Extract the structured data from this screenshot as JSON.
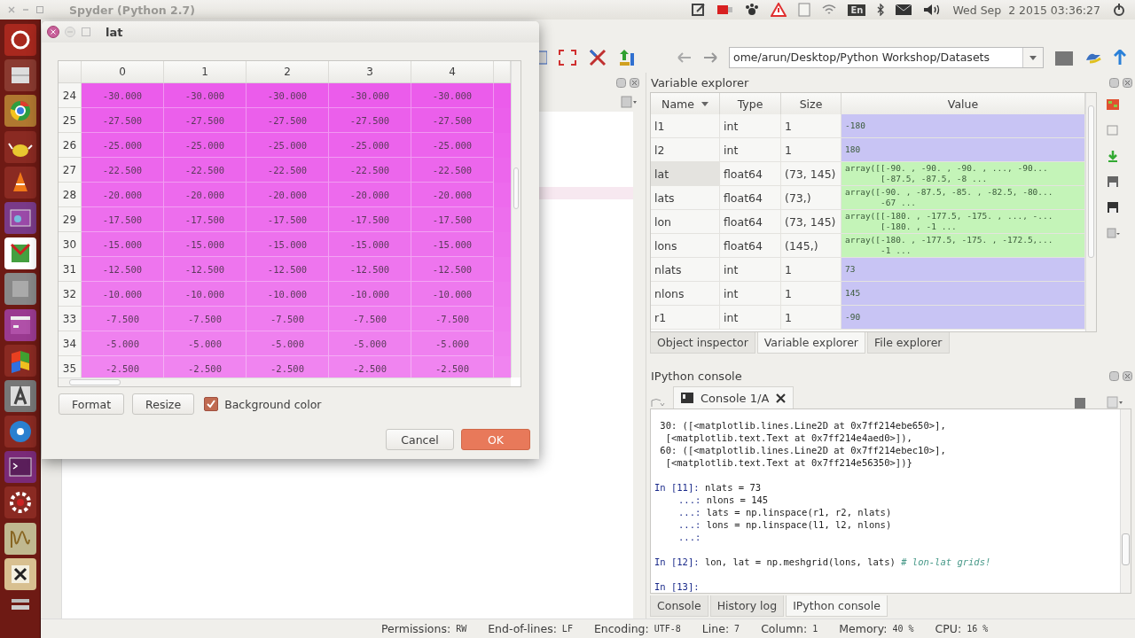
{
  "top_panel": {
    "app_title": "Spyder (Python 2.7)",
    "keyboard_layout": "En",
    "clock": "Wed Sep  2 2015 03:36:27"
  },
  "toolbar": {
    "path": "ome/arun/Desktop/Python Workshop/Datasets"
  },
  "variable_explorer": {
    "title": "Variable explorer",
    "columns": [
      "Name",
      "Type",
      "Size",
      "Value"
    ],
    "rows": [
      {
        "name": "l1",
        "type": "int",
        "size": "1",
        "value": "-180",
        "color": "#c8c4f4",
        "selected": false
      },
      {
        "name": "l2",
        "type": "int",
        "size": "1",
        "value": "180",
        "color": "#c8c4f4",
        "selected": false
      },
      {
        "name": "lat",
        "type": "float64",
        "size": "(73, 145)",
        "value": "array([[-90. , -90. , -90. , ..., -90...\n       [-87.5, -87.5, -8 ...",
        "color": "#c4f4b8",
        "selected": true
      },
      {
        "name": "lats",
        "type": "float64",
        "size": "(73,)",
        "value": "array([-90. , -87.5, -85. , -82.5, -80...\n       -67 ...",
        "color": "#c4f4b8",
        "selected": false
      },
      {
        "name": "lon",
        "type": "float64",
        "size": "(73, 145)",
        "value": "array([[-180. , -177.5, -175. , ..., -...\n       [-180. , -1 ...",
        "color": "#c4f4b8",
        "selected": false
      },
      {
        "name": "lons",
        "type": "float64",
        "size": "(145,)",
        "value": "array([-180. , -177.5, -175. , -172.5,...\n       -1 ...",
        "color": "#c4f4b8",
        "selected": false
      },
      {
        "name": "nlats",
        "type": "int",
        "size": "1",
        "value": "73",
        "color": "#c8c4f4",
        "selected": false
      },
      {
        "name": "nlons",
        "type": "int",
        "size": "1",
        "value": "145",
        "color": "#c8c4f4",
        "selected": false
      },
      {
        "name": "r1",
        "type": "int",
        "size": "1",
        "value": "-90",
        "color": "#c8c4f4",
        "selected": false
      }
    ],
    "tabs": [
      {
        "label": "Object inspector",
        "selected": false
      },
      {
        "label": "Variable explorer",
        "selected": true
      },
      {
        "label": "File explorer",
        "selected": false
      }
    ]
  },
  "ipython_console": {
    "title": "IPython console",
    "console_tab": "Console 1/A",
    "lines": [
      {
        "kind": "output",
        "text": " 30: ([<matplotlib.lines.Line2D at 0x7ff214ebe650>],"
      },
      {
        "kind": "output",
        "text": "  [<matplotlib.text.Text at 0x7ff214e4aed0>]),"
      },
      {
        "kind": "output",
        "text": " 60: ([<matplotlib.lines.Line2D at 0x7ff214ebec10>],"
      },
      {
        "kind": "output",
        "text": "  [<matplotlib.text.Text at 0x7ff214e56350>])}"
      },
      {
        "kind": "blank"
      },
      {
        "kind": "input",
        "prompt": "In [11]:",
        "code": "nlats = 73"
      },
      {
        "kind": "continuation",
        "prompt": "...:",
        "code": "nlons = 145"
      },
      {
        "kind": "continuation",
        "prompt": "...:",
        "code": "lats = np.linspace(r1, r2, nlats)"
      },
      {
        "kind": "continuation",
        "prompt": "...:",
        "code": "lons = np.linspace(l1, l2, nlons)"
      },
      {
        "kind": "continuation",
        "prompt": "...:"
      },
      {
        "kind": "blank"
      },
      {
        "kind": "input",
        "prompt": "In [12]:",
        "code": "lon, lat = np.meshgrid(lons, lats)",
        "comment": "# lon-lat grids!"
      },
      {
        "kind": "blank"
      },
      {
        "kind": "input",
        "prompt": "In [13]:"
      }
    ],
    "tabs": [
      {
        "label": "Console",
        "selected": false
      },
      {
        "label": "History log",
        "selected": false
      },
      {
        "label": "IPython console",
        "selected": true
      }
    ]
  },
  "status_bar": [
    {
      "label": "Permissions:",
      "value": "RW"
    },
    {
      "label": "End-of-lines:",
      "value": "LF"
    },
    {
      "label": "Encoding:",
      "value": "UTF-8"
    },
    {
      "label": "Line:",
      "value": "7"
    },
    {
      "label": "Column:",
      "value": "1"
    },
    {
      "label": "Memory:",
      "value": "40 %"
    },
    {
      "label": "CPU:",
      "value": "16 %"
    }
  ],
  "dialog": {
    "title": "lat",
    "columns": [
      "0",
      "1",
      "2",
      "3",
      "4"
    ],
    "rows": [
      {
        "header": "24",
        "cells": [
          "-30.000",
          "-30.000",
          "-30.000",
          "-30.000",
          "-30.000"
        ]
      },
      {
        "header": "25",
        "cells": [
          "-27.500",
          "-27.500",
          "-27.500",
          "-27.500",
          "-27.500"
        ]
      },
      {
        "header": "26",
        "cells": [
          "-25.000",
          "-25.000",
          "-25.000",
          "-25.000",
          "-25.000"
        ]
      },
      {
        "header": "27",
        "cells": [
          "-22.500",
          "-22.500",
          "-22.500",
          "-22.500",
          "-22.500"
        ]
      },
      {
        "header": "28",
        "cells": [
          "-20.000",
          "-20.000",
          "-20.000",
          "-20.000",
          "-20.000"
        ]
      },
      {
        "header": "29",
        "cells": [
          "-17.500",
          "-17.500",
          "-17.500",
          "-17.500",
          "-17.500"
        ]
      },
      {
        "header": "30",
        "cells": [
          "-15.000",
          "-15.000",
          "-15.000",
          "-15.000",
          "-15.000"
        ]
      },
      {
        "header": "31",
        "cells": [
          "-12.500",
          "-12.500",
          "-12.500",
          "-12.500",
          "-12.500"
        ]
      },
      {
        "header": "32",
        "cells": [
          "-10.000",
          "-10.000",
          "-10.000",
          "-10.000",
          "-10.000"
        ]
      },
      {
        "header": "33",
        "cells": [
          "-7.500",
          "-7.500",
          "-7.500",
          "-7.500",
          "-7.500"
        ]
      },
      {
        "header": "34",
        "cells": [
          "-5.000",
          "-5.000",
          "-5.000",
          "-5.000",
          "-5.000"
        ]
      },
      {
        "header": "35",
        "cells": [
          "-2.500",
          "-2.500",
          "-2.500",
          "-2.500",
          "-2.500"
        ]
      }
    ],
    "tool_buttons": [
      "Format",
      "Resize"
    ],
    "background_color": {
      "label": "Background color",
      "checked": true
    },
    "dialog_buttons": [
      {
        "label": "Cancel",
        "default": false
      },
      {
        "label": "OK",
        "default": true
      }
    ]
  }
}
